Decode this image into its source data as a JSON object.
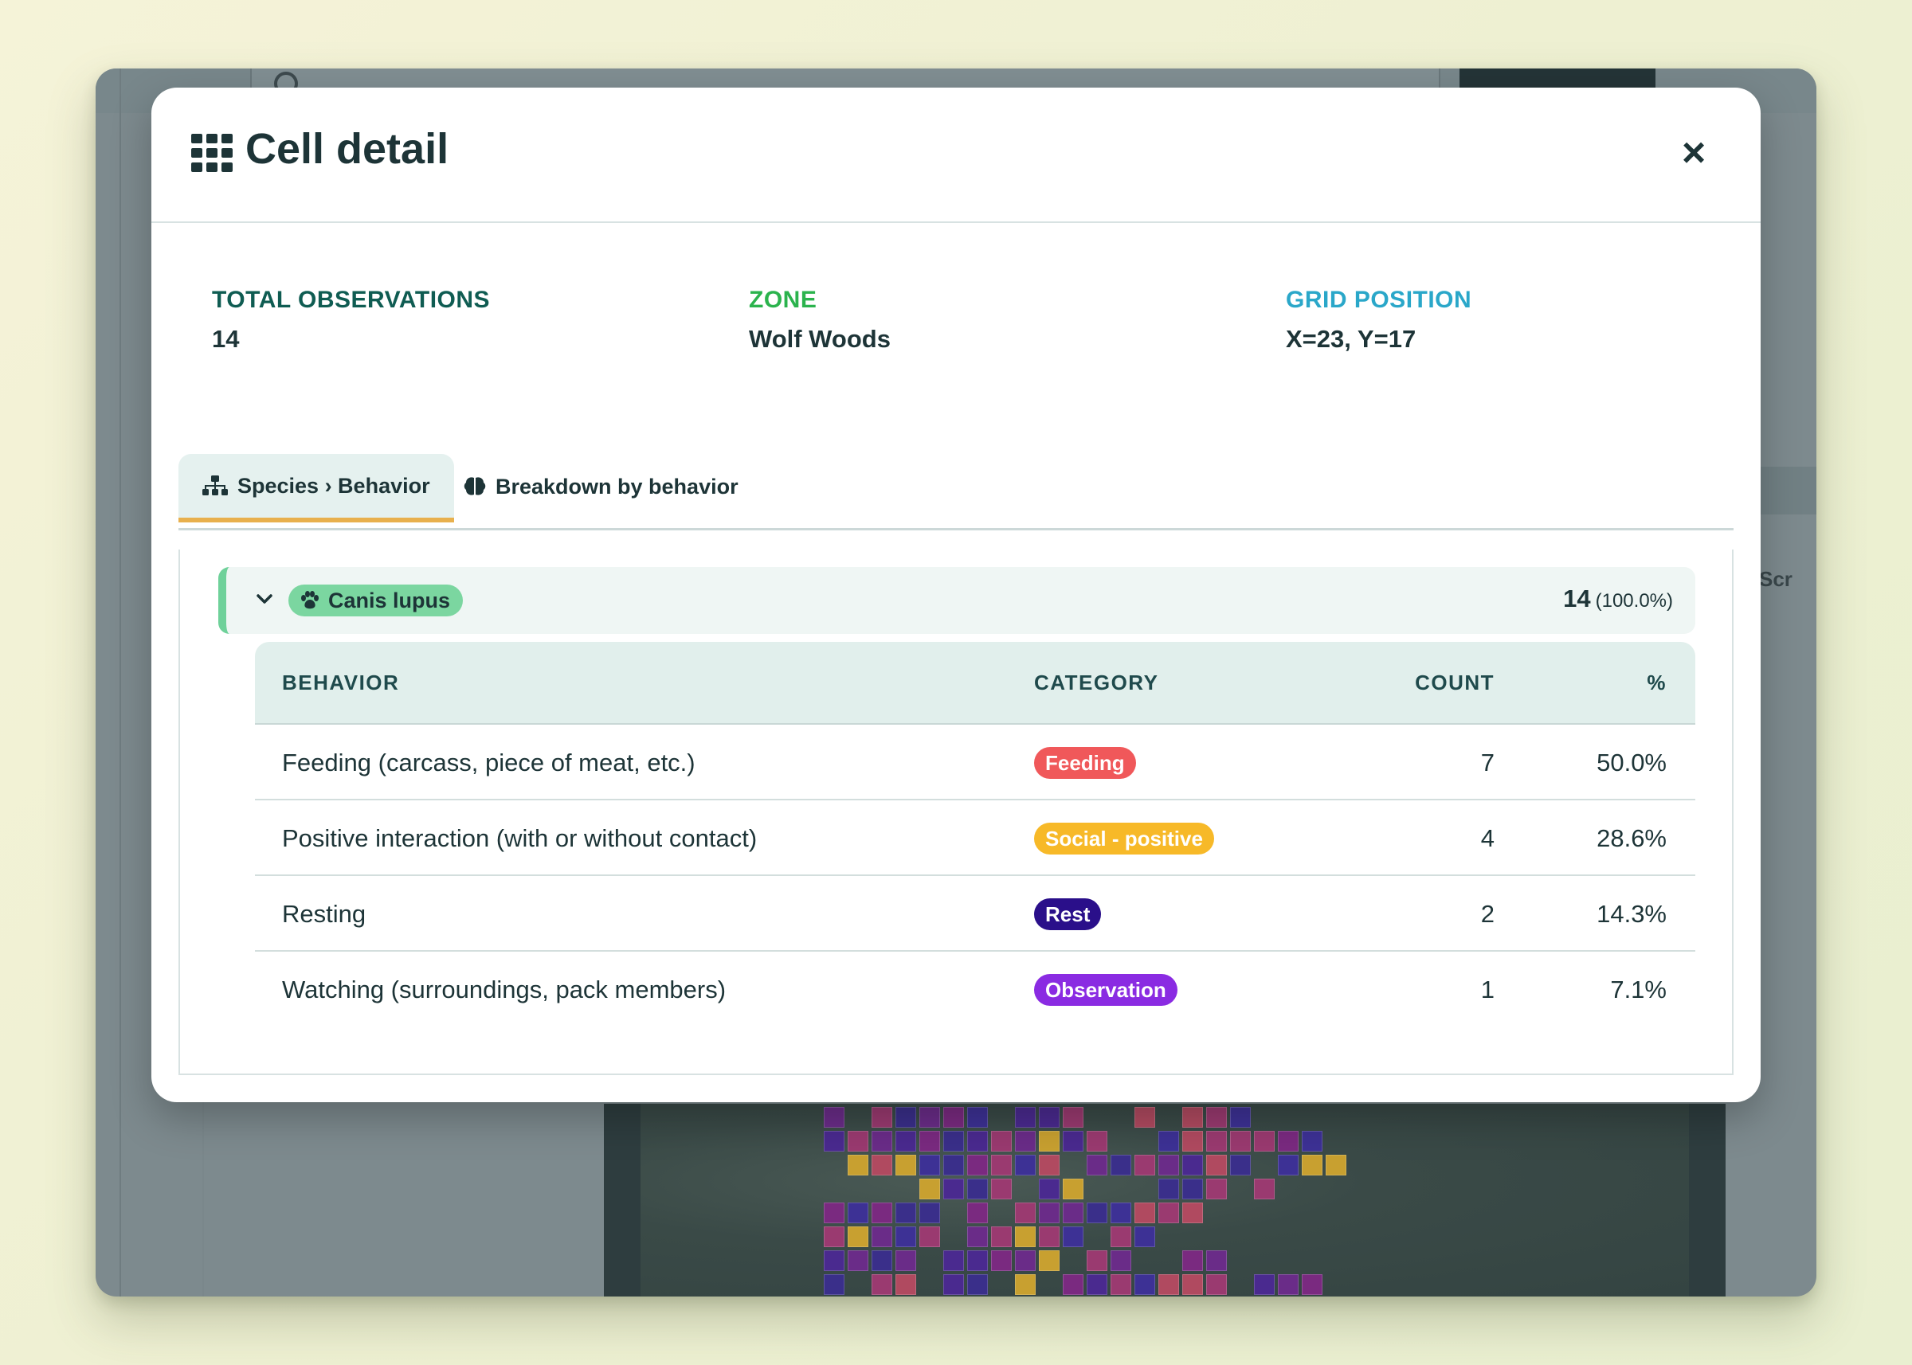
{
  "modal": {
    "title": "Cell detail",
    "close_label": "×",
    "stats": [
      {
        "label": "TOTAL OBSERVATIONS",
        "value": "14",
        "color": "#0f5c52"
      },
      {
        "label": "ZONE",
        "value": "Wolf Woods",
        "color": "#2bb34d"
      },
      {
        "label": "GRID POSITION",
        "value": "X=23, Y=17",
        "color": "#2aa7c9"
      }
    ],
    "tabs": [
      {
        "label": "Species › Behavior",
        "icon": "hierarchy-icon",
        "active": true
      },
      {
        "label": "Breakdown by behavior",
        "icon": "brain-icon",
        "active": false
      }
    ],
    "species": {
      "name": "Canis lupus",
      "icon": "paw-icon",
      "count": "14",
      "percent": "(100.0%)"
    },
    "table": {
      "headers": {
        "behavior": "BEHAVIOR",
        "category": "CATEGORY",
        "count": "COUNT",
        "percent": "%"
      },
      "rows": [
        {
          "behavior": "Feeding (carcass, piece of meat, etc.)",
          "category": "Feeding",
          "category_color": "#f0585a",
          "count": "7",
          "percent": "50.0%"
        },
        {
          "behavior": "Positive interaction (with or without contact)",
          "category": "Social - positive",
          "category_color": "#f7b928",
          "count": "4",
          "percent": "28.6%"
        },
        {
          "behavior": "Resting",
          "category": "Rest",
          "category_color": "#2a0f8a",
          "count": "2",
          "percent": "14.3%"
        },
        {
          "behavior": "Watching (surroundings, pack members)",
          "category": "Observation",
          "category_color": "#8a2be2",
          "count": "1",
          "percent": "7.1%"
        }
      ]
    }
  },
  "background": {
    "right_label": "Scr"
  }
}
